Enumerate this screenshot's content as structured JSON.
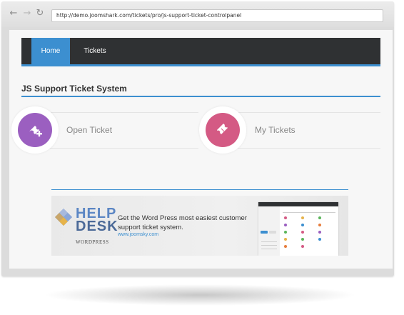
{
  "browser": {
    "url": "http://demo.joomshark.com/tickets/pro/js-support-ticket-controlpanel",
    "back_icon": "arrow-left-icon",
    "forward_icon": "arrow-right-icon",
    "reload_icon": "reload-icon"
  },
  "nav": {
    "items": [
      {
        "label": "Home",
        "active": true
      },
      {
        "label": "Tickets",
        "active": false
      }
    ]
  },
  "page": {
    "title": "JS Support Ticket System"
  },
  "cards": [
    {
      "label": "Open Ticket",
      "icon": "ticket-plus-icon",
      "color": "#9b5fc0"
    },
    {
      "label": "My Tickets",
      "icon": "ticket-icon",
      "color": "#d45a84"
    }
  ],
  "banner": {
    "logo_word_1": "HELP",
    "logo_word_2": "DESK",
    "logo_sub": "WORDPRESS",
    "headline": "Get the Word Press most easiest customer support ticket system.",
    "link": "www.joomsky.com"
  },
  "colors": {
    "accent": "#3c8fd0",
    "navbar": "#2f3133"
  }
}
